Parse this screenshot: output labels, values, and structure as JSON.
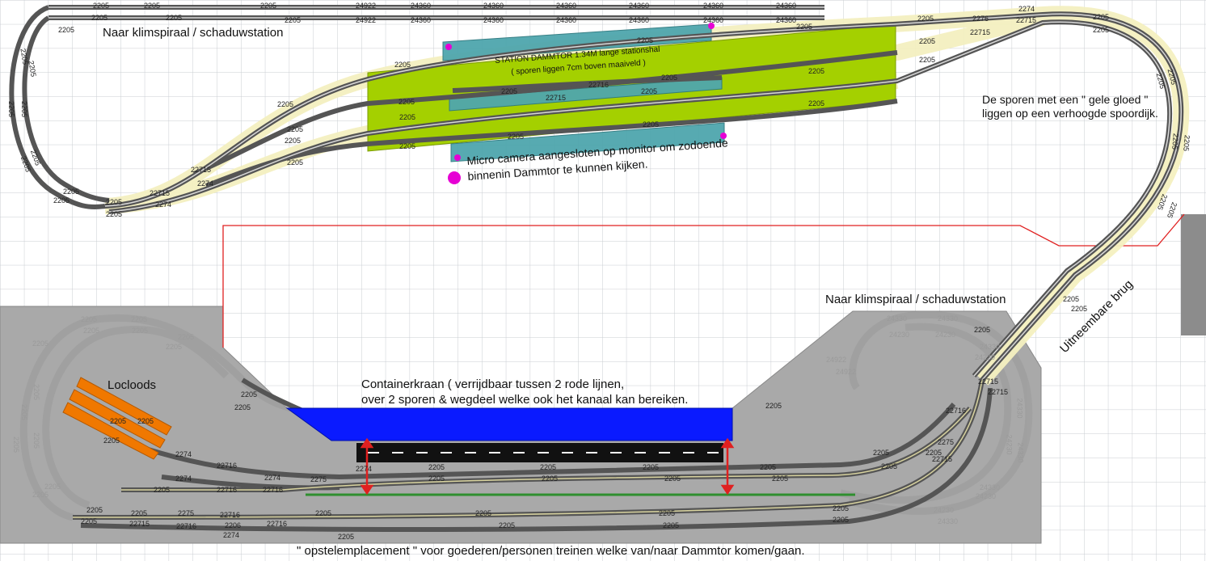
{
  "labels": {
    "to_helix_top": "Naar klimspiraal / schaduwstation",
    "to_helix_bottom": "Naar klimspiraal / schaduwstation",
    "station_title": "STATION DAMMTOR 1.34M lange stationshal",
    "station_subtitle": "( sporen liggen 7cm boven maaiveld )",
    "camera_line1": "Micro camera aangesloten op monitor om zodoende",
    "camera_line2": "binnenin Dammtor te kunnen kijken.",
    "glow_line1": "De sporen met een \" gele gloed \"",
    "glow_line2": "liggen op een verhoogde spoordijk.",
    "bridge": "Uitneembare brug",
    "loco_shed": "Locloods",
    "crane_line1": "Containerkraan ( verrijdbaar tussen 2 rode lijnen,",
    "crane_line2": "over 2 sporen & wegdeel welke ook het kanaal kan bereiken.",
    "yard": "\" opstelemplacement \" voor goederen/personen treinen welke van/naar Dammtor komen/gaan."
  },
  "track_numbers": {
    "n2205": "2205",
    "n2274": "2274",
    "n22715": "22715",
    "n22716": "22716",
    "n2275": "2275",
    "n2206": "2206",
    "n24922": "24922",
    "n24360": "24360",
    "n24330": "24330",
    "n24230": "24230",
    "n2276": "2276"
  },
  "colors": {
    "grid_line": "#c9cdd2",
    "station_platform": "#a4d000",
    "station_hall": "#4fa6ad",
    "ground_plate": "#a9a9a9",
    "crane": "#0a1aff",
    "road": "#111111",
    "canal_line": "#2f8f2f",
    "red_line": "#e02020",
    "loco_shed": "#f07800",
    "camera_marker": "#e600d4",
    "embankment_glow": "#f4f0c0"
  },
  "icons": {
    "camera_marker": "magenta-dot-icon",
    "crane_travel": "red-double-arrow-icon"
  }
}
